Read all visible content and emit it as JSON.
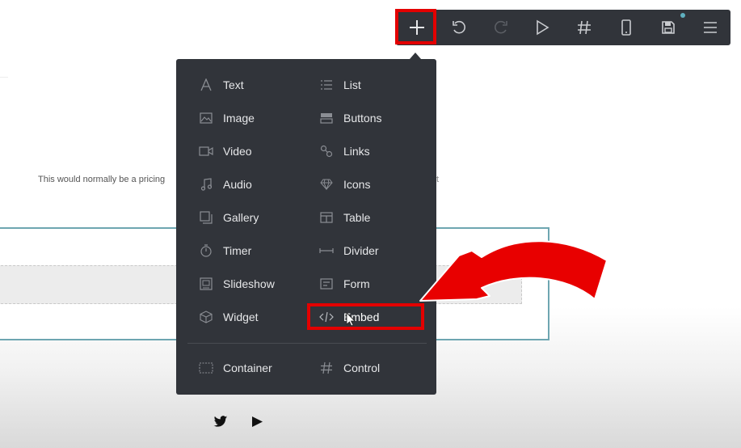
{
  "page": {
    "body_text": "This would normally be a pricing",
    "body_text_tail": "t"
  },
  "toolbar": {
    "buttons": [
      {
        "name": "add",
        "icon": "plus-icon"
      },
      {
        "name": "undo",
        "icon": "undo-icon"
      },
      {
        "name": "redo",
        "icon": "redo-icon"
      },
      {
        "name": "preview",
        "icon": "play-icon"
      },
      {
        "name": "grid",
        "icon": "hash-icon"
      },
      {
        "name": "mobile",
        "icon": "phone-icon"
      },
      {
        "name": "save",
        "icon": "save-icon"
      },
      {
        "name": "menu",
        "icon": "hamburger-icon"
      }
    ]
  },
  "menu": {
    "left": [
      "Text",
      "Image",
      "Video",
      "Audio",
      "Gallery",
      "Timer",
      "Slideshow",
      "Widget"
    ],
    "right": [
      "List",
      "Buttons",
      "Links",
      "Icons",
      "Table",
      "Divider",
      "Form",
      "Embed"
    ],
    "footer_left": "Container",
    "footer_right": "Control"
  },
  "colors": {
    "toolbar_bg": "#31343a",
    "highlight": "#e30000",
    "section_border": "#6ea6b1"
  }
}
